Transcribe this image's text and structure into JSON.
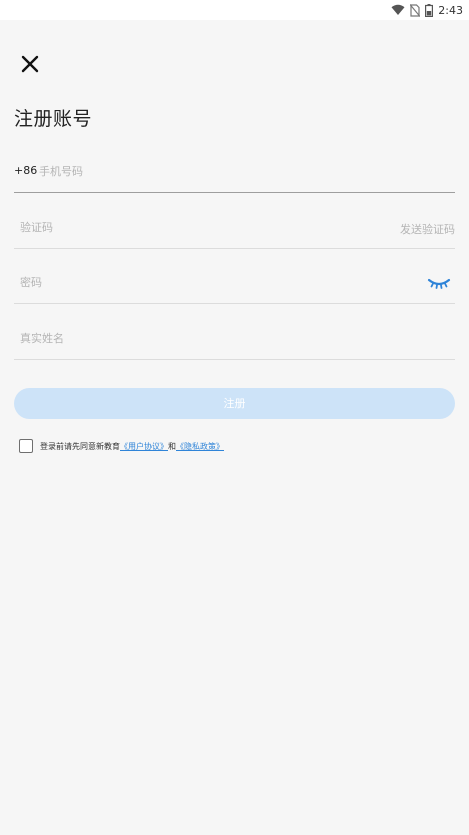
{
  "status_bar": {
    "time": "2:43",
    "icons": [
      "wifi-icon",
      "no-sim-icon",
      "battery-icon"
    ]
  },
  "header": {
    "close_icon": "close-icon",
    "title": "注册账号"
  },
  "form": {
    "phone": {
      "prefix": "+86",
      "placeholder": "手机号码"
    },
    "code": {
      "placeholder": "验证码",
      "send_label": "发送验证码"
    },
    "password": {
      "placeholder": "密码",
      "toggle_icon": "eye-closed-icon"
    },
    "name": {
      "placeholder": "真实姓名"
    },
    "submit_label": "注册"
  },
  "agreement": {
    "text_before": "登录前请先同意新教育",
    "user_agreement": "《用户协议》",
    "conjunction": "和",
    "privacy_policy": "《隐私政策》"
  },
  "colors": {
    "background": "#f6f6f6",
    "accent": "#2f84d8",
    "button_disabled": "#cde3f8"
  }
}
